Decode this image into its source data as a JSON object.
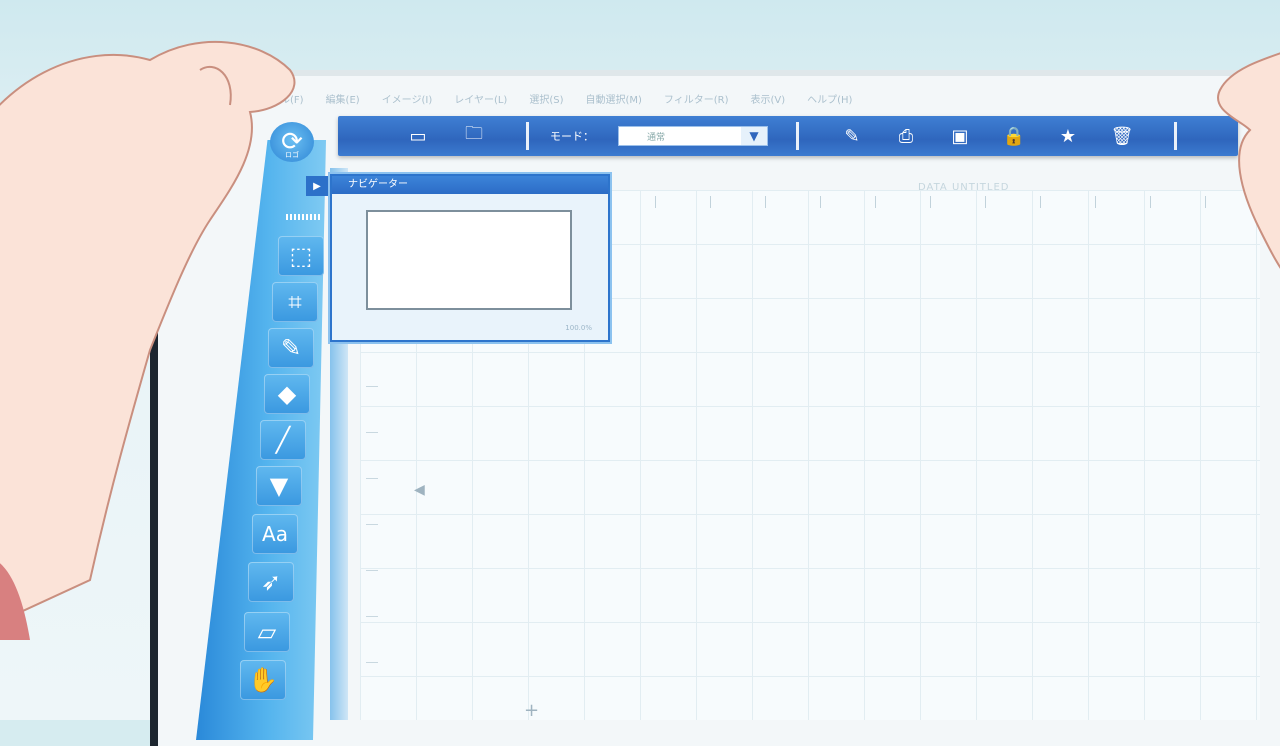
{
  "app": {
    "logo_label": "ロゴ",
    "document_title": "DATA UNTITLED",
    "colors": {
      "toolbar_blue": "#2f66bd",
      "sidebar_blue": "#3a98e0",
      "canvas_bg": "#f7fbfd"
    }
  },
  "menu": [
    {
      "label": "ファイル(F)"
    },
    {
      "label": "編集(E)"
    },
    {
      "label": "イメージ(I)"
    },
    {
      "label": "レイヤー(L)"
    },
    {
      "label": "選択(S)"
    },
    {
      "label": "自動選択(M)"
    },
    {
      "label": "フィルター(R)"
    },
    {
      "label": "表示(V)"
    },
    {
      "label": "ヘルプ(H)"
    }
  ],
  "toolbar": {
    "mode_label": "モード：",
    "mode_value": "通常",
    "buttons": [
      {
        "icon": "window-icon",
        "name": "new-window-button"
      },
      {
        "icon": "open-folder-icon",
        "name": "open-file-button"
      },
      {
        "icon": "edit-icon",
        "name": "edit-button"
      },
      {
        "icon": "print-icon",
        "name": "print-button"
      },
      {
        "icon": "camera-icon",
        "name": "capture-button"
      },
      {
        "icon": "lock-icon",
        "name": "lock-button"
      },
      {
        "icon": "star-icon",
        "name": "favorite-button"
      },
      {
        "icon": "trash-icon",
        "name": "delete-button"
      }
    ]
  },
  "navigator": {
    "title": "ナビゲーター",
    "zoom": "100.0%"
  },
  "tools": [
    {
      "icon": "marquee-select-icon",
      "glyph": "⬚"
    },
    {
      "icon": "crop-icon",
      "glyph": "⌗"
    },
    {
      "icon": "eyedropper-icon",
      "glyph": "✎"
    },
    {
      "icon": "eraser-icon",
      "glyph": "◆"
    },
    {
      "icon": "pencil-icon",
      "glyph": "╱"
    },
    {
      "icon": "paint-bucket-icon",
      "glyph": "▼"
    },
    {
      "icon": "text-tool-icon",
      "glyph": "Aa"
    },
    {
      "icon": "move-arrow-icon",
      "glyph": "➶"
    },
    {
      "icon": "shape-tool-icon",
      "glyph": "▱"
    },
    {
      "icon": "hand-tool-icon",
      "glyph": "✋"
    }
  ]
}
